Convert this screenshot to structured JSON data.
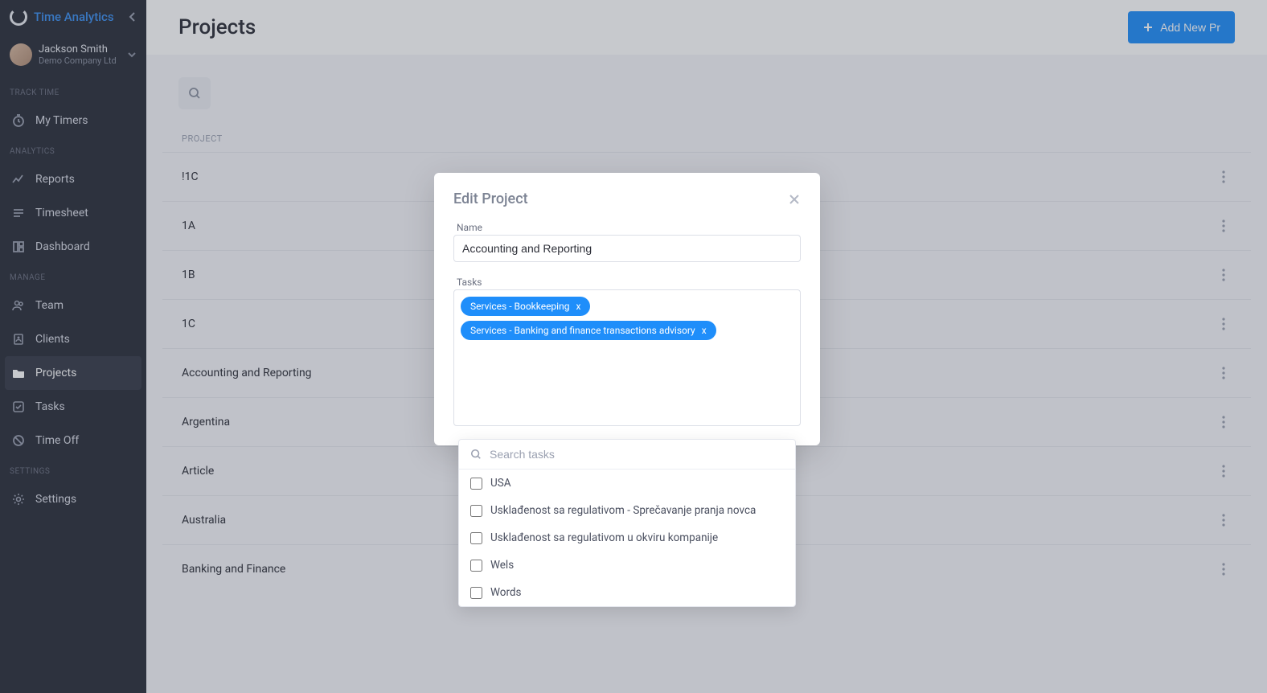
{
  "brand": "Time Analytics",
  "user": {
    "name": "Jackson Smith",
    "company": "Demo Company Ltd"
  },
  "sidebar": {
    "sections": {
      "track": "TRACK TIME",
      "analytics": "ANALYTICS",
      "manage": "MANAGE",
      "settings": "SETTINGS"
    },
    "items": {
      "timers": "My Timers",
      "reports": "Reports",
      "timesheet": "Timesheet",
      "dashboard": "Dashboard",
      "team": "Team",
      "clients": "Clients",
      "projects": "Projects",
      "tasks": "Tasks",
      "timeoff": "Time Off",
      "settings": "Settings"
    }
  },
  "page": {
    "title": "Projects",
    "add_button": "Add New Pr",
    "column_project": "PROJECT"
  },
  "projects": [
    "!1C",
    "1A",
    "1B",
    "1C",
    "Accounting and Reporting",
    "Argentina",
    "Article",
    "Australia",
    "Banking and Finance"
  ],
  "modal": {
    "title": "Edit Project",
    "name_label": "Name",
    "name_value": "Accounting and Reporting",
    "tasks_label": "Tasks",
    "chips": [
      "Services - Bookkeeping",
      "Services - Banking and finance transactions advisory"
    ]
  },
  "dropdown": {
    "placeholder": "Search tasks",
    "options": [
      "USA",
      "Usklađenost sa regulativom - Sprečavanje pranja novca",
      "Usklađenost sa regulativom u okviru kompanije",
      "Wels",
      "Words"
    ]
  }
}
